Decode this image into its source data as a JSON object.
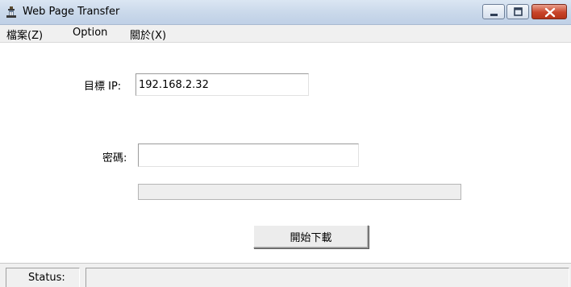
{
  "window": {
    "title": "Web Page Transfer",
    "accent": "#c8442a"
  },
  "menu": {
    "items": [
      {
        "label": "檔案(Z)"
      },
      {
        "label": "Option"
      },
      {
        "label": "關於(X)"
      }
    ]
  },
  "form": {
    "ip_label": "目標 IP:",
    "ip_value": "192.168.2.32",
    "password_label": "密碼:",
    "password_value": "",
    "progress_fraction": 0,
    "start_button_label": "開始下載"
  },
  "status": {
    "label": "Status:",
    "value": ""
  }
}
